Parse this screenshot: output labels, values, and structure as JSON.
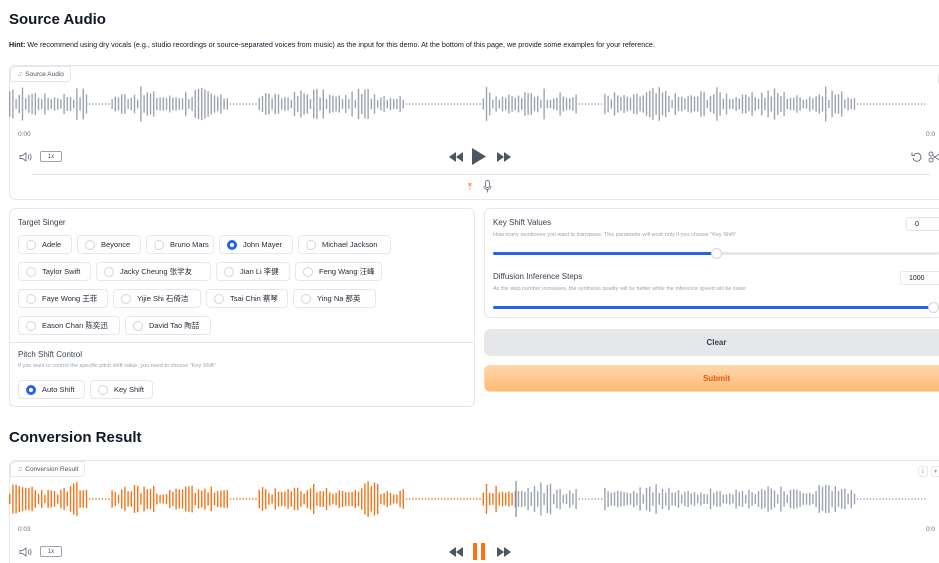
{
  "sections": {
    "source_title": "Source Audio",
    "result_title": "Conversion Result"
  },
  "hint": {
    "bold": "Hint:",
    "text": " We recommend using dry vocals (e.g., studio recordings or source-separated voices from music) as the input for this demo. At the bottom of this page, we provide some examples for your reference."
  },
  "source_audio": {
    "tag_label": "Source Audio",
    "tag_icon": "♫",
    "time_current": "0:00",
    "time_end": "0:0",
    "speed": "1x",
    "clear_icon": "×",
    "upload_icon": "⤒",
    "mic_icon": "🎙",
    "wave_color": "#9ca3af"
  },
  "result_audio": {
    "tag_label": "Conversion Result",
    "tag_icon": "♫",
    "time_current": "0:03",
    "time_end": "0:0",
    "speed": "1x",
    "played_color": "#f97316",
    "unplayed_color": "#9ca3af",
    "download_icon": "⤓"
  },
  "target_singer": {
    "label": "Target Singer",
    "options": [
      "Adele",
      "Beyonce",
      "Bruno Mars",
      "John Mayer",
      "Michael Jackson",
      "Taylor Swift",
      "Jacky Cheung 张学友",
      "Jian Li 李健",
      "Feng Wang 汪峰",
      "Faye Wong 王菲",
      "Yijie Shi 石倚洁",
      "Tsai Chin 蔡琴",
      "Ying Na 那英",
      "Eason Chan 陈奕迅",
      "David Tao 陶喆"
    ],
    "selected": "John Mayer"
  },
  "pitch_shift": {
    "label": "Pitch Shift Control",
    "desc": "If you want to control the specific pitch shift value, you need to choose \"Key Shift\"",
    "options": [
      "Auto Shift",
      "Key Shift"
    ],
    "selected": "Auto Shift"
  },
  "key_shift": {
    "label": "Key Shift Values",
    "desc": "How many semitones you want to transpose. This parameter will work only if you choose \"Key Shift\"",
    "value": "0",
    "fraction": 0.5
  },
  "diffusion_steps": {
    "label": "Diffusion Inference Steps",
    "desc": "As the step number increases, the synthesis quality will be better while the inference speed will be lower",
    "value": "1000",
    "fraction": 1.0
  },
  "buttons": {
    "clear": "Clear",
    "submit": "Submit"
  },
  "colors": {
    "accent_blue": "#2563eb",
    "accent_orange": "#f97316"
  }
}
